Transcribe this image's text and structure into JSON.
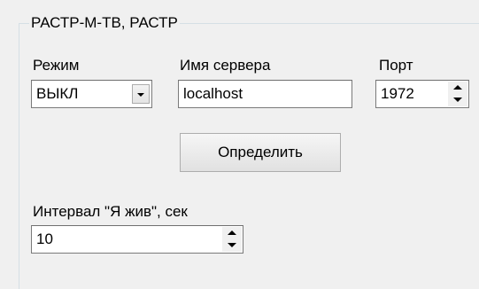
{
  "group": {
    "title": "РАСТР-М-ТВ, РАСТР"
  },
  "mode": {
    "label": "Режим",
    "value": "ВЫКЛ"
  },
  "server": {
    "label": "Имя сервера",
    "value": "localhost"
  },
  "port": {
    "label": "Порт",
    "value": "1972"
  },
  "detect_button": {
    "label": "Определить"
  },
  "interval": {
    "label": "Интервал \"Я жив\", сек",
    "value": "10"
  }
}
